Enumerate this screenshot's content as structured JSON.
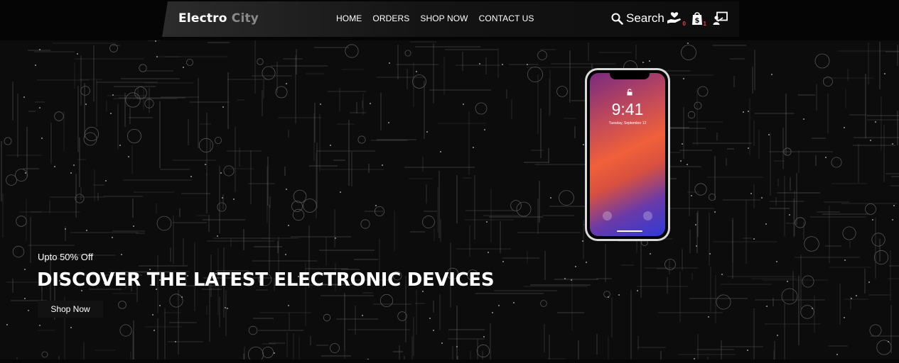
{
  "brand": {
    "part1": "Electro",
    "part2": "City"
  },
  "nav": {
    "items": [
      {
        "label": "HOME"
      },
      {
        "label": "ORDERS"
      },
      {
        "label": "SHOP NOW"
      },
      {
        "label": "CONTACT US"
      }
    ]
  },
  "header_actions": {
    "search_label": "Search",
    "cart_count": "0",
    "bag_count": "1"
  },
  "hero": {
    "promo": "Upto 50% Off",
    "headline": "DISCOVER THE LATEST ELECTRONIC DEVICES",
    "cta": "Shop Now"
  },
  "phone": {
    "time": "9:41",
    "date": "Tuesday, September 12"
  },
  "colors": {
    "accent_badge": "#ff3b3b",
    "background": "#050505"
  }
}
